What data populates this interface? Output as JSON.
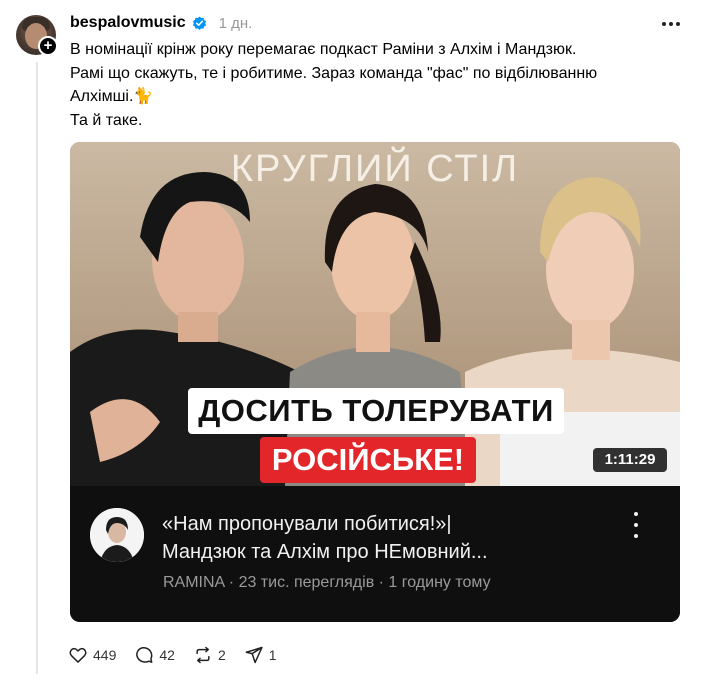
{
  "post": {
    "username": "bespalovmusic",
    "time": "1 дн.",
    "lines": [
      "В номінації крінж року перемагає подкаст Раміни з Алхім і Мандзюк.",
      "Рамі що скажуть, те і робитиме. Зараз команда \"фас\" по відбілюванню",
      "Алхімші.🐈",
      "Та й таке."
    ]
  },
  "video": {
    "thumbnail_title": "КРУГЛИЙ СТІЛ",
    "headline_top": "ДОСИТЬ ТОЛЕРУВАТИ",
    "headline_bottom": "РОСІЙСЬКЕ!",
    "duration": "1:11:29",
    "title_line1": "«Нам пропонували побитися!»|",
    "title_line2": "Мандзюк та Алхім про НЕмовний...",
    "meta": "RAMINA · 23 тис. переглядів · 1 годину тому"
  },
  "actions": {
    "likes": "449",
    "comments": "42",
    "reposts": "2",
    "shares": "1"
  },
  "colors": {
    "accent_red": "#e3262a",
    "verified_blue": "#0095f6",
    "muted_text": "#999999"
  },
  "icons": [
    "plus-icon",
    "verified-icon",
    "more-icon",
    "kebab-icon",
    "heart-icon",
    "comment-icon",
    "repost-icon",
    "share-icon"
  ]
}
